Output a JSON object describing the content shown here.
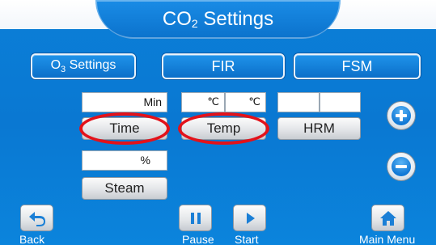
{
  "header": {
    "title_main": "CO",
    "title_sub": "2",
    "title_rest": " Settings"
  },
  "tabs": {
    "o3": {
      "main": "O",
      "sub": "3",
      "rest": " Settings"
    },
    "fir": "FIR",
    "fsm": "FSM"
  },
  "time": {
    "value": "",
    "unit": "Min",
    "label": "Time"
  },
  "temp": {
    "value_1": "",
    "unit_1": "℃",
    "value_2": "",
    "unit_2": "℃",
    "label": "Temp"
  },
  "hrm": {
    "value_1": "",
    "value_2": "",
    "label": "HRM"
  },
  "steam": {
    "value": "",
    "unit": "%",
    "label": "Steam"
  },
  "footer": {
    "back": "Back",
    "pause": "Pause",
    "start": "Start",
    "main_menu": "Main Menu"
  },
  "highlight_color": "#e3121a",
  "icons": {
    "plus": "plus-icon",
    "minus": "minus-icon",
    "back": "back-arrow-icon",
    "pause": "pause-icon",
    "start": "play-icon",
    "main_menu": "home-icon"
  }
}
